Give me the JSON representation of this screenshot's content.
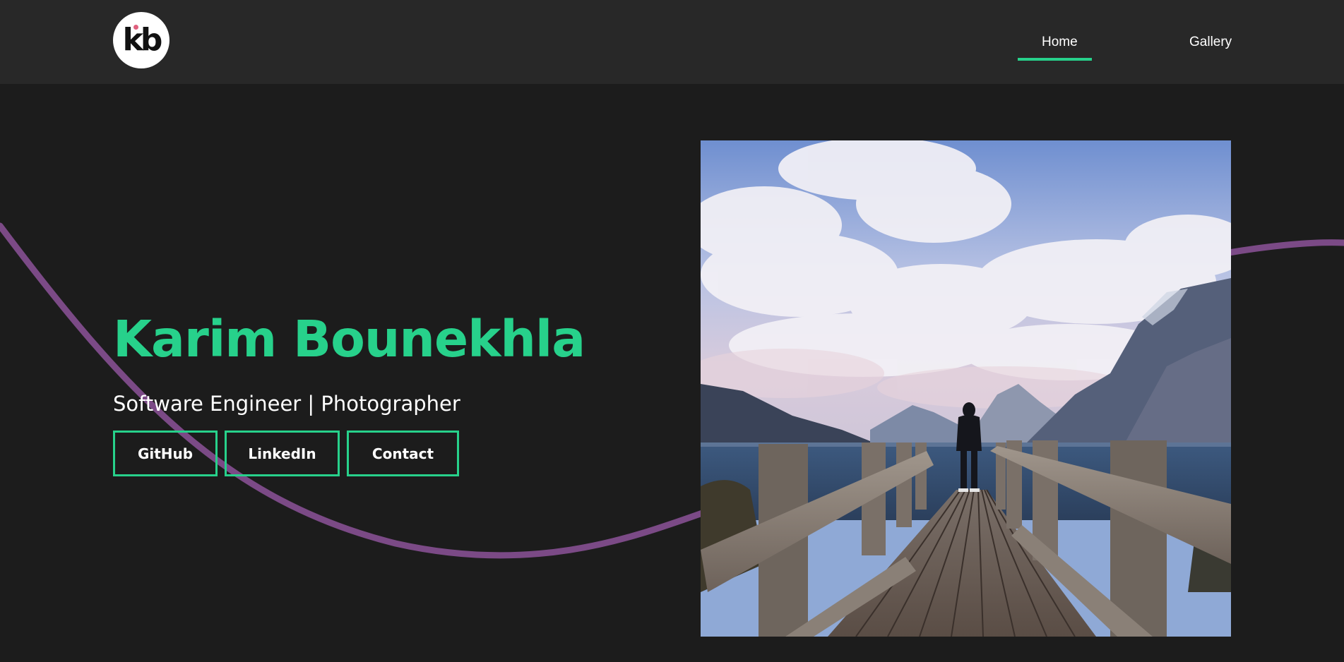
{
  "header": {
    "logo_text": "kb",
    "nav": [
      {
        "label": "Home",
        "active": true
      },
      {
        "label": "Gallery",
        "active": false
      }
    ]
  },
  "hero": {
    "name": "Karim Bounekhla",
    "subtitle": "Software Engineer | Photographer",
    "buttons": [
      {
        "label": "GitHub"
      },
      {
        "label": "LinkedIn"
      },
      {
        "label": "Contact"
      }
    ]
  },
  "theme": {
    "background": "#1c1c1c",
    "header_background": "#282828",
    "accent": "#27d18b",
    "curve": "#7b4a86"
  }
}
